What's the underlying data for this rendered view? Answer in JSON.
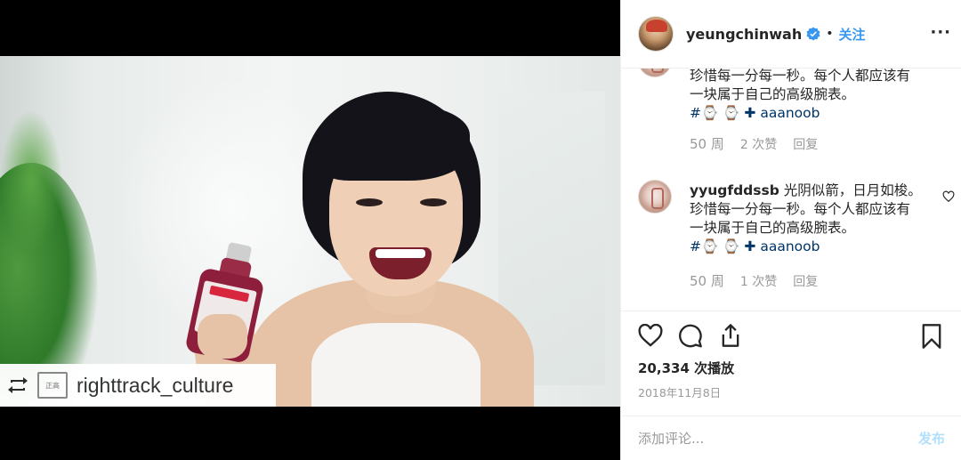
{
  "post": {
    "username": "yeungchinwah",
    "follow_label": "关注",
    "dot": "•",
    "more_label": "···",
    "verified": true
  },
  "media": {
    "repost_name": "righttrack_culture",
    "repost_logo_text": "正高"
  },
  "comments": [
    {
      "user": "",
      "text_lines": [
        "珍惜每一分每一秒。每个人都应该有",
        "一块属于自己的高级腕表。"
      ],
      "tags": "#⌚ ⌚ ✚ aaanoob",
      "time": "50 周",
      "likes": "2 次赞",
      "reply": "回复"
    },
    {
      "user": "yyugfddssb",
      "text_lines": [
        "光阴似箭，日月如梭。",
        "珍惜每一分每一秒。每个人都应该有",
        "一块属于自己的高级腕表。"
      ],
      "tags": "#⌚ ⌚ ✚ aaanoob",
      "time": "50 周",
      "likes": "1 次赞",
      "reply": "回复"
    }
  ],
  "stats": {
    "plays": "20,334 次播放",
    "date": "2018年11月8日"
  },
  "add_comment": {
    "placeholder": "添加评论...",
    "post_label": "发布"
  },
  "colors": {
    "accent": "#3897f0",
    "post_disabled": "#b2dffc",
    "tag": "#003569",
    "meta": "#999999"
  },
  "icons": [
    "heart-icon",
    "comment-icon",
    "share-icon",
    "bookmark-icon",
    "repost-icon",
    "verified-badge-icon",
    "more-options-icon"
  ]
}
